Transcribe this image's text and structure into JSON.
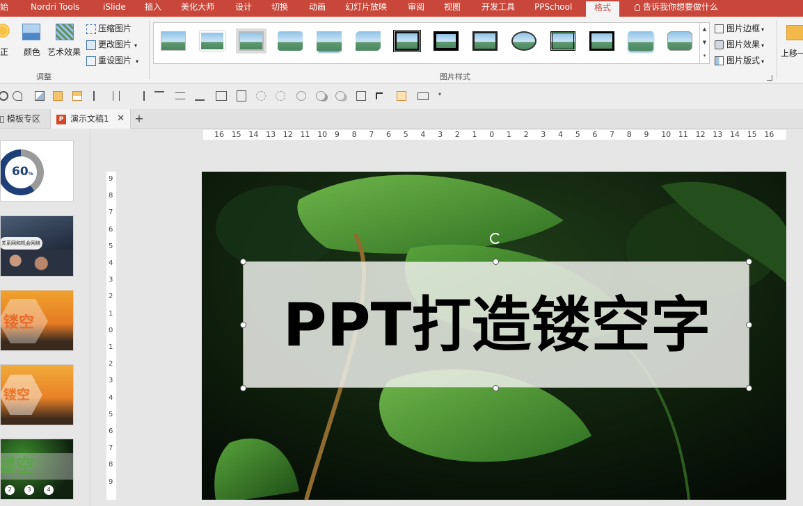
{
  "menu": {
    "tabs": [
      "始",
      "Nordri Tools",
      "iSlide",
      "插入",
      "美化大师",
      "设计",
      "切换",
      "动画",
      "幻灯片放映",
      "审阅",
      "视图",
      "开发工具",
      "PPSchool",
      "格式"
    ],
    "active": "格式",
    "tell_me": "告诉我你想要做什么"
  },
  "ribbon": {
    "adjust": {
      "correct": "校正",
      "color": "颜色",
      "art_effect": "艺术效果",
      "compress": "压缩图片",
      "change": "更改图片",
      "reset": "重设图片",
      "group_label": "调整"
    },
    "styles": {
      "group_label": "图片样式"
    },
    "right": {
      "border": "图片边框",
      "effect": "图片效果",
      "layout": "图片版式",
      "move_up": "上移一"
    }
  },
  "doc_tabs": {
    "template": "模板专区",
    "doc": "演示文稿1",
    "add": "+"
  },
  "thumbnails": {
    "t1_number": "60",
    "t1_suffix": "%",
    "t2_caption": "关系网和机会网络",
    "t3_text": "镂空",
    "t4_text": "镂空",
    "t5_text": "镂空",
    "t5_nums": [
      "2",
      "3",
      "4"
    ]
  },
  "ruler": {
    "h": [
      "16",
      "15",
      "14",
      "13",
      "12",
      "11",
      "10",
      "9",
      "8",
      "7",
      "6",
      "5",
      "4",
      "3",
      "2",
      "1",
      "0",
      "1",
      "2",
      "3",
      "4",
      "5",
      "6",
      "7",
      "8",
      "9",
      "10",
      "11",
      "12",
      "13",
      "14",
      "15",
      "16"
    ],
    "v": [
      "9",
      "8",
      "7",
      "6",
      "5",
      "4",
      "3",
      "2",
      "1",
      "0",
      "1",
      "2",
      "3",
      "4",
      "5",
      "6",
      "7",
      "8",
      "9"
    ]
  },
  "slide": {
    "title": "PPT打造镂空字"
  },
  "colors": {
    "accent": "#c8473a",
    "ribbon_bg": "#f3f3f3",
    "leaf_green": "#3f8a2e"
  }
}
